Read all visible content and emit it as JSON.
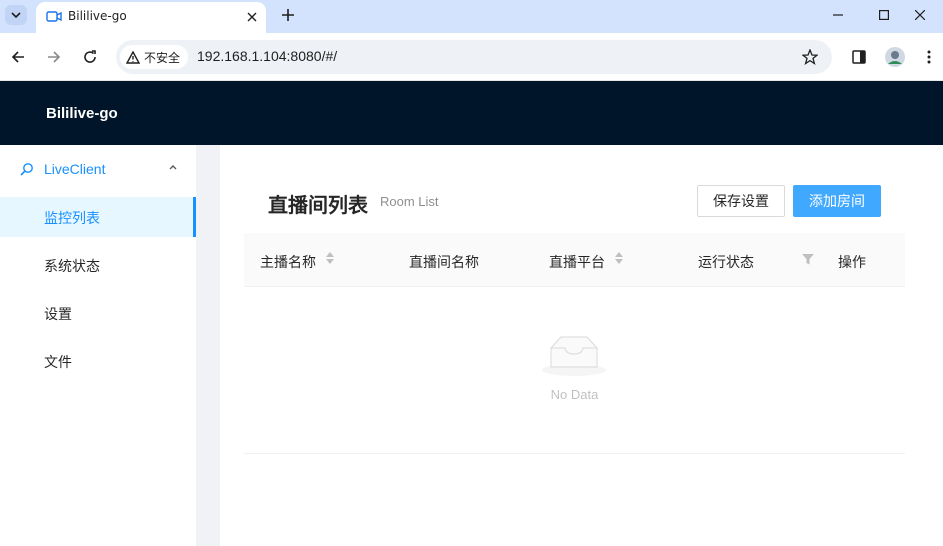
{
  "browser": {
    "tab_title": "Bililive-go",
    "security_label": "不安全",
    "url": "192.168.1.104:8080/#/"
  },
  "app": {
    "title": "Bililive-go"
  },
  "sidebar": {
    "submenu_label": "LiveClient",
    "items": [
      {
        "label": "监控列表",
        "active": true
      },
      {
        "label": "系统状态",
        "active": false
      },
      {
        "label": "设置",
        "active": false
      },
      {
        "label": "文件",
        "active": false
      }
    ]
  },
  "page": {
    "title": "直播间列表",
    "subtitle": "Room List",
    "buttons": {
      "save_settings": "保存设置",
      "add_room": "添加房间"
    }
  },
  "table": {
    "columns": [
      {
        "label": "主播名称",
        "sortable": true
      },
      {
        "label": "直播间名称",
        "sortable": false
      },
      {
        "label": "直播平台",
        "sortable": true
      },
      {
        "label": "运行状态",
        "filterable": true
      },
      {
        "label": "操作"
      }
    ],
    "rows": [],
    "empty_text": "No Data"
  },
  "colors": {
    "header_bg": "#001529",
    "accent": "#1890ff",
    "primary_button": "#40a9ff",
    "tab_strip": "#d3e3fd"
  },
  "icons": [
    "chevron-down-icon",
    "camera-favicon-icon",
    "close-icon",
    "plus-icon",
    "minimize-icon",
    "maximize-icon",
    "window-close-icon",
    "back-arrow-icon",
    "forward-arrow-icon",
    "reload-icon",
    "warning-icon",
    "star-icon",
    "sidebar-panel-icon",
    "profile-avatar",
    "more-vert-icon",
    "search-icon",
    "chevron-up-icon",
    "sort-icon",
    "filter-icon",
    "empty-inbox-icon"
  ]
}
